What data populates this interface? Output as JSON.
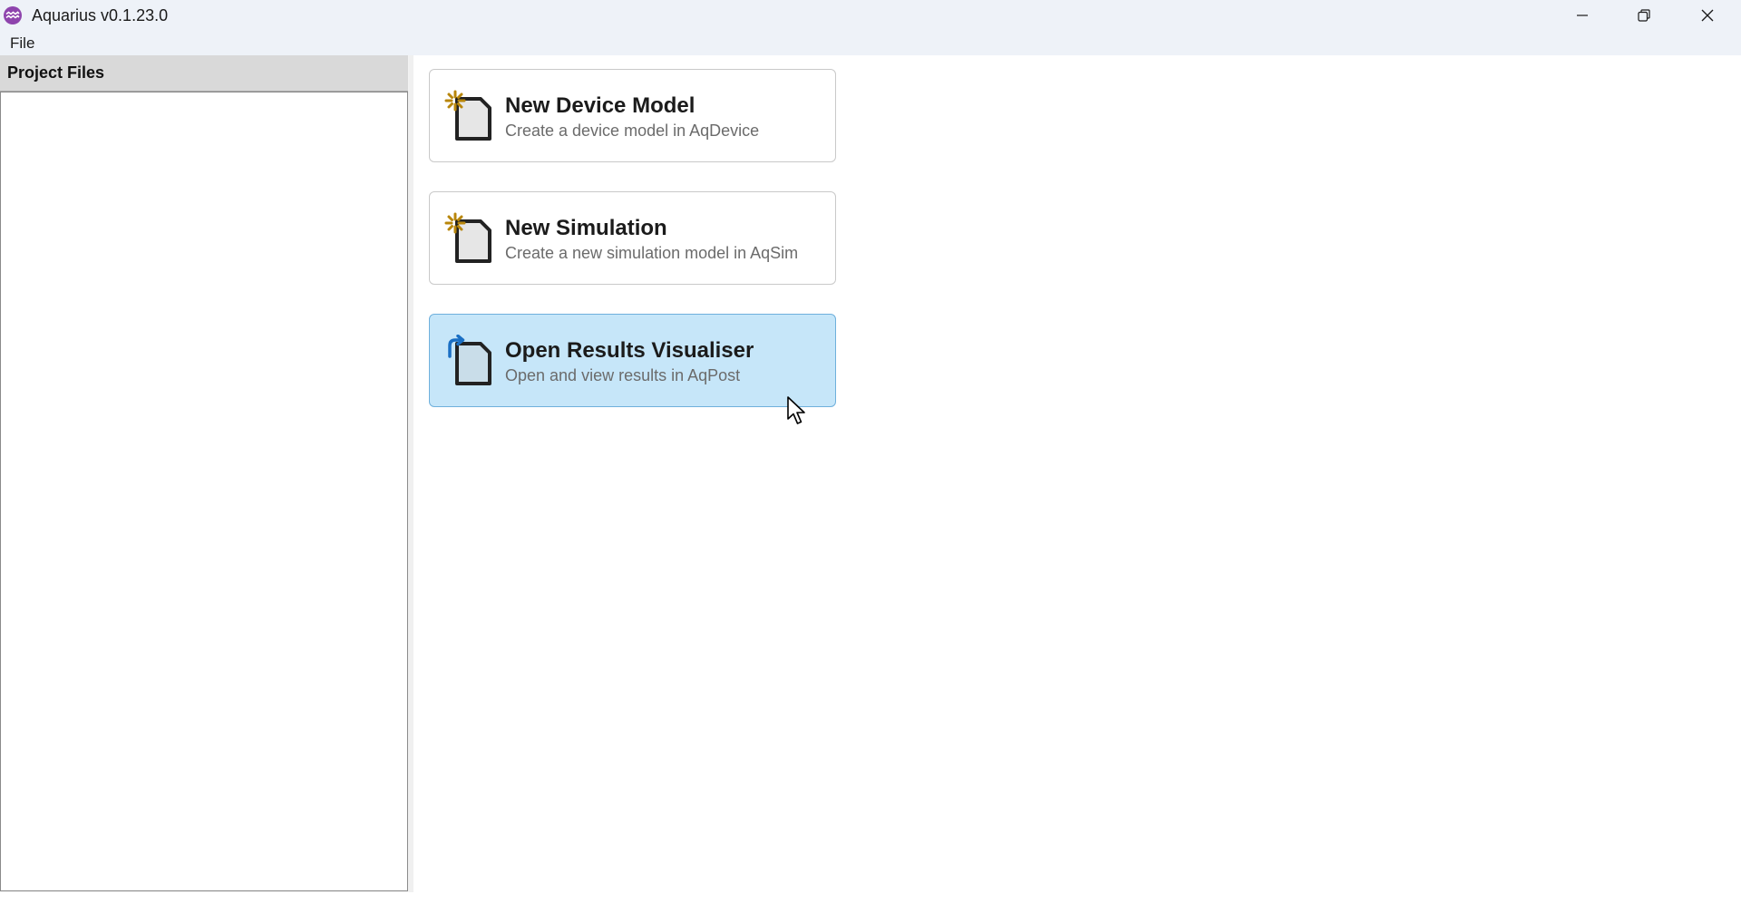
{
  "window": {
    "title": "Aquarius v0.1.23.0",
    "app_icon": "aquarius-logo-icon",
    "controls": [
      "minimize-icon",
      "restore-icon",
      "close-icon"
    ]
  },
  "menubar": {
    "items": [
      {
        "label": "File"
      }
    ]
  },
  "left_pane": {
    "header": "Project Files"
  },
  "actions": [
    {
      "title": "New Device Model",
      "subtitle": "Create a device model in AqDevice",
      "icon": "new-file-icon",
      "state": "normal"
    },
    {
      "title": "New Simulation",
      "subtitle": "Create a new simulation model in AqSim",
      "icon": "new-file-icon",
      "state": "normal"
    },
    {
      "title": "Open Results Visualiser",
      "subtitle": "Open and view results in AqPost",
      "icon": "open-file-icon",
      "state": "hover"
    }
  ],
  "colors": {
    "titlebar_bg": "#eef2f8",
    "hover_card_bg": "#c6e6f9",
    "hover_card_border": "#6fb0dc",
    "new_icon_accent": "#b8860b",
    "open_icon_accent": "#1a6fc4",
    "app_icon_color": "#8e44ad"
  }
}
